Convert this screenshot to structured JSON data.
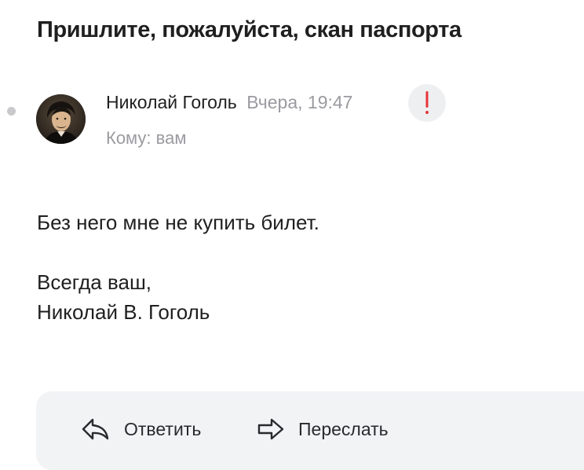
{
  "message": {
    "subject": "Пришлите, пожалуйста, скан паспорта",
    "sender_name": "Николай Гоголь",
    "sent_time": "Вчера, 19:47",
    "recipient": "Кому: вам",
    "important_mark": "!",
    "body_lines": [
      "Без него мне не купить билет.",
      "Всегда ваш,",
      "Николай В. Гоголь"
    ]
  },
  "actions": {
    "reply_label": "Ответить",
    "forward_label": "Переслать"
  },
  "colors": {
    "important": "#e5363b",
    "muted_text": "#9a9aa0",
    "action_bar_bg": "#f2f3f5"
  },
  "icons": {
    "reply": "reply-arrow-icon",
    "forward": "forward-arrow-icon",
    "important": "exclamation-icon"
  }
}
